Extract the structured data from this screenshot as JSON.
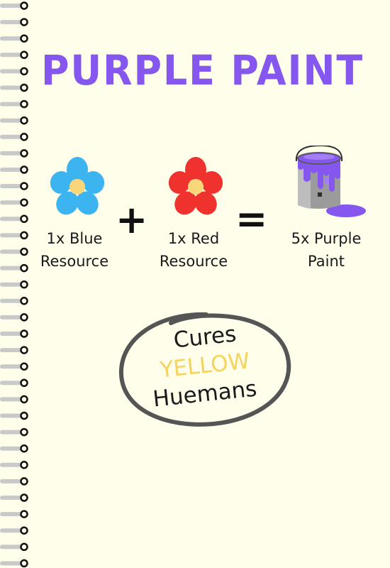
{
  "title": "PURPLE PAINT",
  "recipe": {
    "ingredient1": {
      "line1": "1x Blue",
      "line2": "Resource",
      "icon": "blue-flower-icon",
      "color": "#3cb4f0"
    },
    "plus": "+",
    "ingredient2": {
      "line1": "1x Red",
      "line2": "Resource",
      "icon": "red-flower-icon",
      "color": "#f0322f"
    },
    "equals": "=",
    "result": {
      "line1": "5x Purple",
      "line2": "Paint",
      "icon": "paint-can-icon",
      "color": "#8657ee"
    }
  },
  "badge": {
    "line1": "Cures",
    "line2": "YELLOW",
    "line3": "Huemans"
  },
  "colors": {
    "background": "#fffeea",
    "title": "#8657ee",
    "highlight": "#f4d45c",
    "flower_center": "#fad67a"
  }
}
